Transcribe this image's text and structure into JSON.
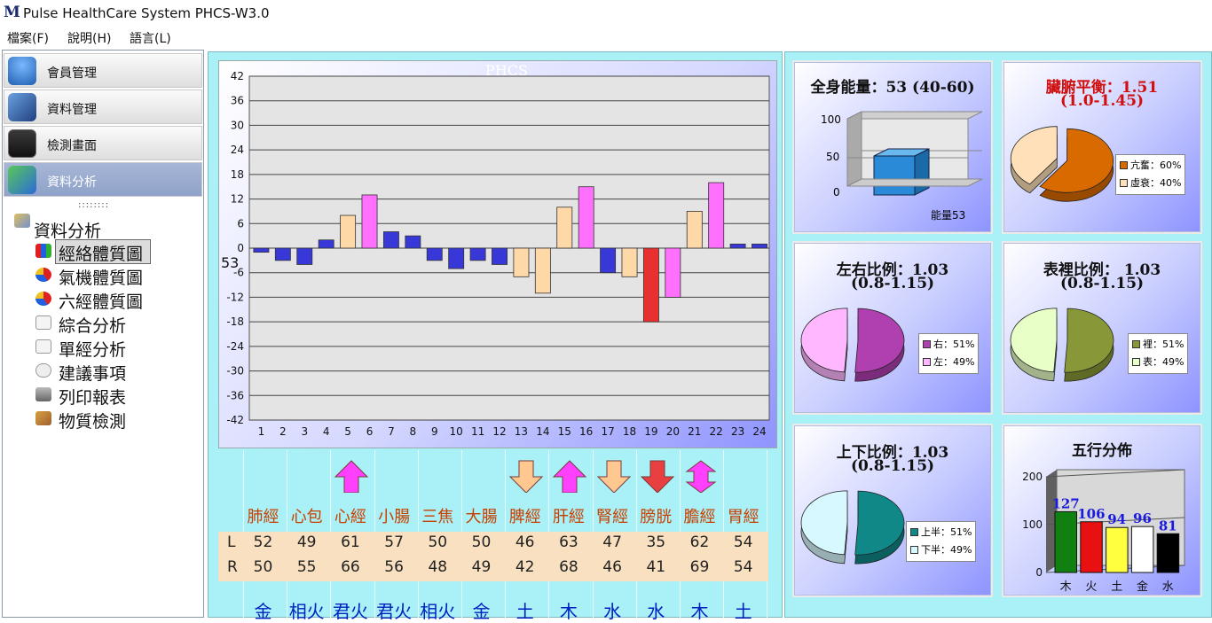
{
  "window": {
    "logo_text": "M",
    "title": "Pulse HealthCare System  PHCS-W3.0"
  },
  "menu": [
    {
      "label": "檔案(F)"
    },
    {
      "label": "說明(H)"
    },
    {
      "label": "語言(L)"
    }
  ],
  "nav": [
    {
      "label": "會員管理",
      "icon": "member-icon",
      "active": false
    },
    {
      "label": "資料管理",
      "icon": "data-management-icon",
      "active": false
    },
    {
      "label": "檢測畫面",
      "icon": "measure-screen-icon",
      "active": false
    },
    {
      "label": "資料分析",
      "icon": "data-analysis-icon",
      "active": true
    }
  ],
  "splitter": "::::::::",
  "tree": {
    "root": "資料分析",
    "items": [
      {
        "label": "經絡體質圖",
        "icon": "bar-chart-icon",
        "selected": true
      },
      {
        "label": "氣機體質圖",
        "icon": "pie-chart-icon",
        "selected": false
      },
      {
        "label": "六經體質圖",
        "icon": "pie-chart-icon",
        "selected": false
      },
      {
        "label": "綜合分析",
        "icon": "document-icon",
        "selected": false
      },
      {
        "label": "單經分析",
        "icon": "checklist-icon",
        "selected": false
      },
      {
        "label": "建議事項",
        "icon": "speech-bubble-icon",
        "selected": false
      },
      {
        "label": "列印報表",
        "icon": "printer-icon",
        "selected": false
      },
      {
        "label": "物質檢測",
        "icon": "tools-icon",
        "selected": false
      }
    ]
  },
  "chart_data": {
    "type": "bar",
    "title": "PHCS",
    "baseline_label": "53",
    "ylim": [
      -42,
      42
    ],
    "yticks": [
      42,
      36,
      30,
      24,
      18,
      12,
      6,
      0,
      -6,
      -12,
      -18,
      -24,
      -30,
      -36,
      -42
    ],
    "categories": [
      "1",
      "2",
      "3",
      "4",
      "5",
      "6",
      "7",
      "8",
      "9",
      "10",
      "11",
      "12",
      "13",
      "14",
      "15",
      "16",
      "17",
      "18",
      "19",
      "20",
      "21",
      "22",
      "23",
      "24"
    ],
    "values": [
      -1,
      -3,
      -4,
      2,
      8,
      13,
      4,
      3,
      -3,
      -5,
      -3,
      -4,
      -7,
      -11,
      10,
      15,
      -6,
      -7,
      -18,
      -12,
      9,
      16,
      1,
      1
    ],
    "bar_colors": [
      "#3838d8",
      "#3838d8",
      "#3838d8",
      "#3838d8",
      "#ffd8a8",
      "#ff70ff",
      "#3838d8",
      "#3838d8",
      "#3838d8",
      "#3838d8",
      "#3838d8",
      "#3838d8",
      "#ffd8a8",
      "#ffd8a8",
      "#ffd8a8",
      "#ff70ff",
      "#3838d8",
      "#ffd8a8",
      "#e83030",
      "#ff70ff",
      "#ffd8a8",
      "#ff70ff",
      "#3838d8",
      "#3838d8"
    ]
  },
  "meridians": {
    "names": [
      "肺經",
      "心包",
      "心經",
      "小腸",
      "三焦",
      "大腸",
      "脾經",
      "肝經",
      "腎經",
      "膀胱",
      "膽經",
      "胃經"
    ],
    "arrows": [
      "",
      "",
      "up-magenta",
      "",
      "",
      "",
      "down-peach",
      "up-magenta",
      "down-peach",
      "down-red",
      "both-magenta",
      ""
    ],
    "row_l_label": "L",
    "row_r_label": "R",
    "left": [
      "52",
      "49",
      "61",
      "57",
      "50",
      "50",
      "46",
      "63",
      "47",
      "35",
      "62",
      "54"
    ],
    "right": [
      "50",
      "55",
      "66",
      "56",
      "48",
      "49",
      "42",
      "68",
      "46",
      "41",
      "69",
      "54"
    ],
    "elements": [
      "金",
      "相火",
      "君火",
      "君火",
      "相火",
      "金",
      "土",
      "木",
      "水",
      "水",
      "木",
      "土"
    ]
  },
  "cards": {
    "energy": {
      "title": "全身能量：53 (40-60)",
      "value": 53,
      "yticks": [
        "100",
        "50",
        "0"
      ],
      "xlabel": "能量53"
    },
    "organ_balance": {
      "title_line1": "臟腑平衡：1.51",
      "title_line2": "(1.0-1.45)",
      "title_color": "#d01010",
      "legend": [
        {
          "label": "亢奮：60%",
          "value": 60,
          "color": "#d86a00"
        },
        {
          "label": "虛衰：40%",
          "value": 40,
          "color": "#ffe0b8"
        }
      ]
    },
    "left_right": {
      "title_line1": "左右比例：1.03",
      "title_line2": "(0.8-1.15)",
      "legend": [
        {
          "label": "右：51%",
          "value": 51,
          "color": "#b040b0"
        },
        {
          "label": "左：49%",
          "value": 49,
          "color": "#ffb8ff"
        }
      ]
    },
    "surface_inner": {
      "title_line1": "表裡比例： 1.03",
      "title_line2": "(0.8-1.15)",
      "legend": [
        {
          "label": "裡：51%",
          "value": 51,
          "color": "#889838"
        },
        {
          "label": "表：49%",
          "value": 49,
          "color": "#e8ffc8"
        }
      ]
    },
    "upper_lower": {
      "title_line1": "上下比例：1.03",
      "title_line2": "(0.8-1.15)",
      "legend": [
        {
          "label": "上半：51%",
          "value": 51,
          "color": "#108888"
        },
        {
          "label": "下半：49%",
          "value": 49,
          "color": "#d8f8ff"
        }
      ]
    },
    "five_elements": {
      "title": "五行分佈",
      "yticks": [
        "200",
        "100",
        "0"
      ],
      "categories": [
        "木",
        "火",
        "土",
        "金",
        "水"
      ],
      "values": [
        127,
        106,
        94,
        96,
        81
      ],
      "colors": [
        "#108010",
        "#e81010",
        "#ffff40",
        "#ffffff",
        "#000000"
      ]
    }
  }
}
